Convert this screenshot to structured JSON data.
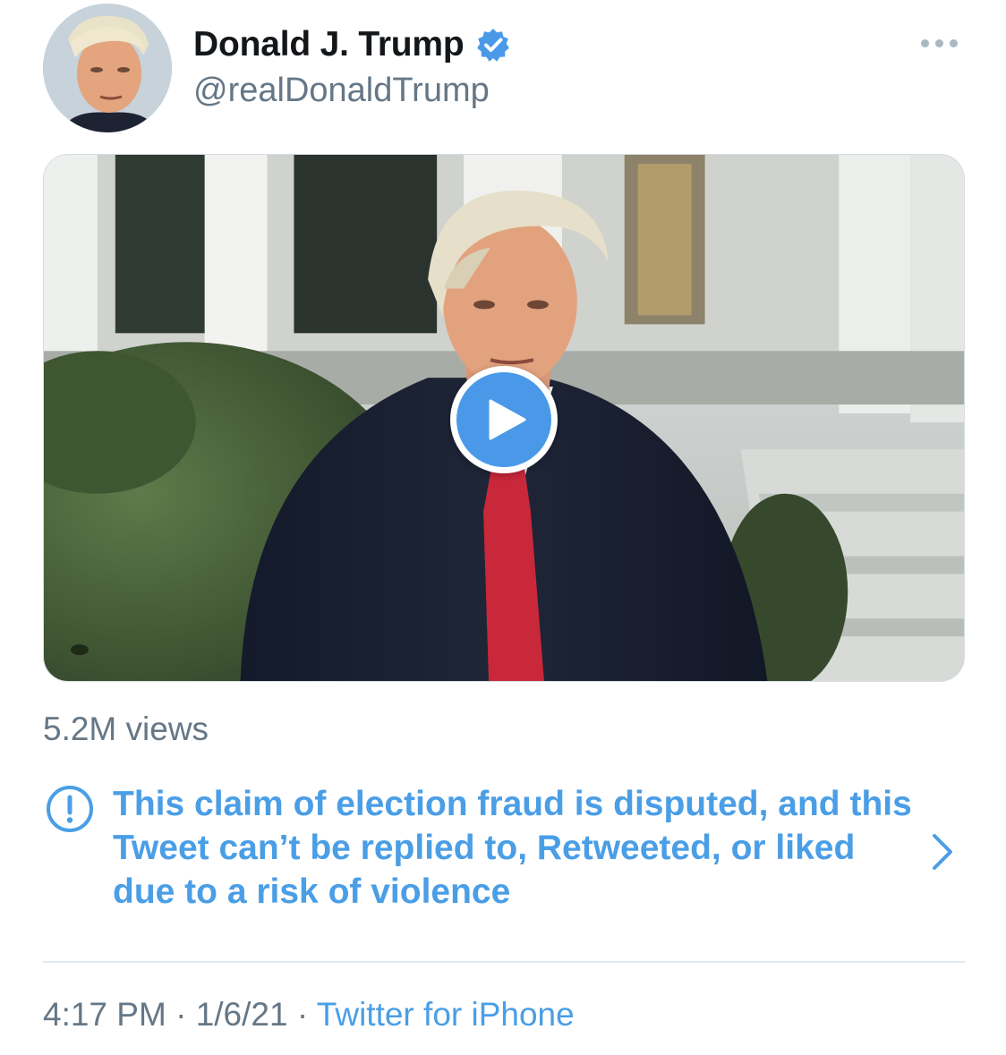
{
  "author": {
    "display_name": "Donald J. Trump",
    "handle": "@realDonaldTrump",
    "verified": true
  },
  "media": {
    "type": "video",
    "views": "5.2M views"
  },
  "notice": {
    "text": "This claim of election fraud is disputed, and this Tweet can’t be replied to, Retweeted, or liked due to a risk of violence"
  },
  "meta": {
    "time": "4:17 PM",
    "separator": "·",
    "date": "1/6/21",
    "source": "Twitter for iPhone"
  },
  "colors": {
    "link": "#4a9ee6",
    "play": "#4a99e9",
    "secondary_text": "#657786",
    "divider": "#e1e8ed"
  },
  "icons": {
    "verified": "verified-badge-icon",
    "more": "more-dots-icon",
    "play": "play-icon",
    "notice": "exclamation-circle-icon",
    "chevron": "chevron-right-icon"
  }
}
